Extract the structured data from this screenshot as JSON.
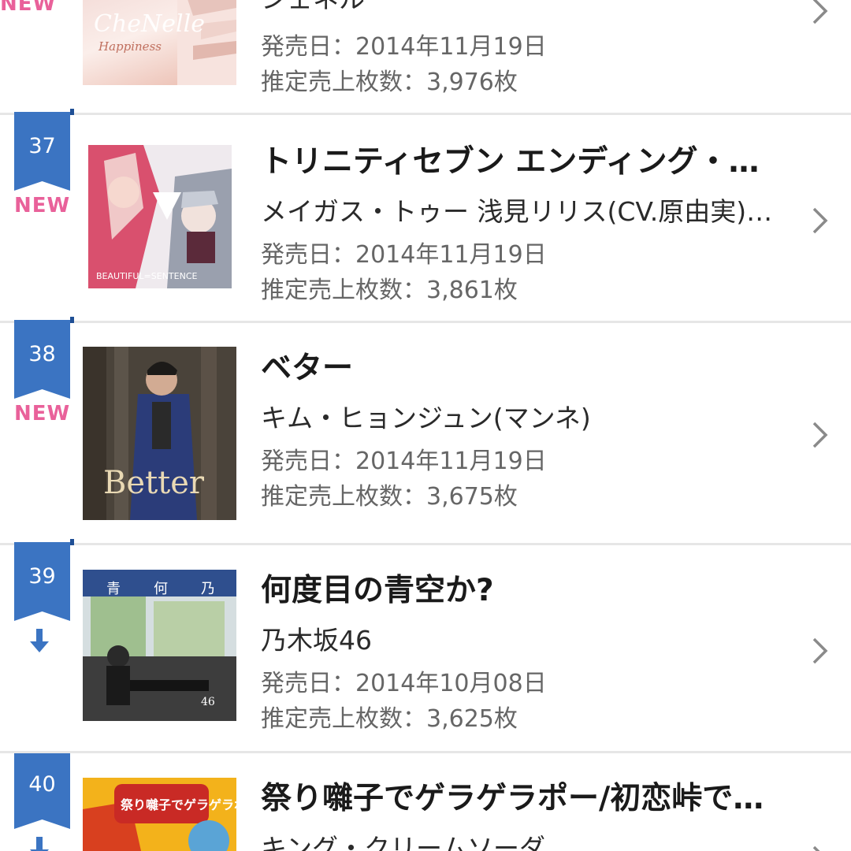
{
  "labels": {
    "release_prefix": "発売日：",
    "sales_prefix": "推定売上枚数：",
    "sales_suffix": "枚"
  },
  "items": [
    {
      "rank": "",
      "badge": "NEW",
      "title": "",
      "artist": "シェネル",
      "cover_text": "CheNelle",
      "cover_subtext": "Happiness",
      "release_date": "2014年11月19日",
      "sales": "3,976"
    },
    {
      "rank": "37",
      "badge": "NEW",
      "title": "トリニティセブン エンディング・…",
      "artist": "メイガス・トゥー 浅見リリス(CV.原由実)…",
      "cover_text": "BEAUTIFUL=SENTENCE",
      "release_date": "2014年11月19日",
      "sales": "3,861"
    },
    {
      "rank": "38",
      "badge": "NEW",
      "title": "ベター",
      "artist": "キム・ヒョンジュン(マンネ)",
      "cover_text": "Better",
      "release_date": "2014年11月19日",
      "sales": "3,675"
    },
    {
      "rank": "39",
      "badge": "down",
      "title": "何度目の青空か?",
      "artist": "乃木坂46",
      "cover_text": "46",
      "release_date": "2014年10月08日",
      "sales": "3,625"
    },
    {
      "rank": "40",
      "badge": "down",
      "title": "祭り囃子でゲラゲラポー/初恋峠で…",
      "artist": "キング・クリームソーダ",
      "cover_text": "祭り囃子でゲラゲラポー"
    }
  ]
}
